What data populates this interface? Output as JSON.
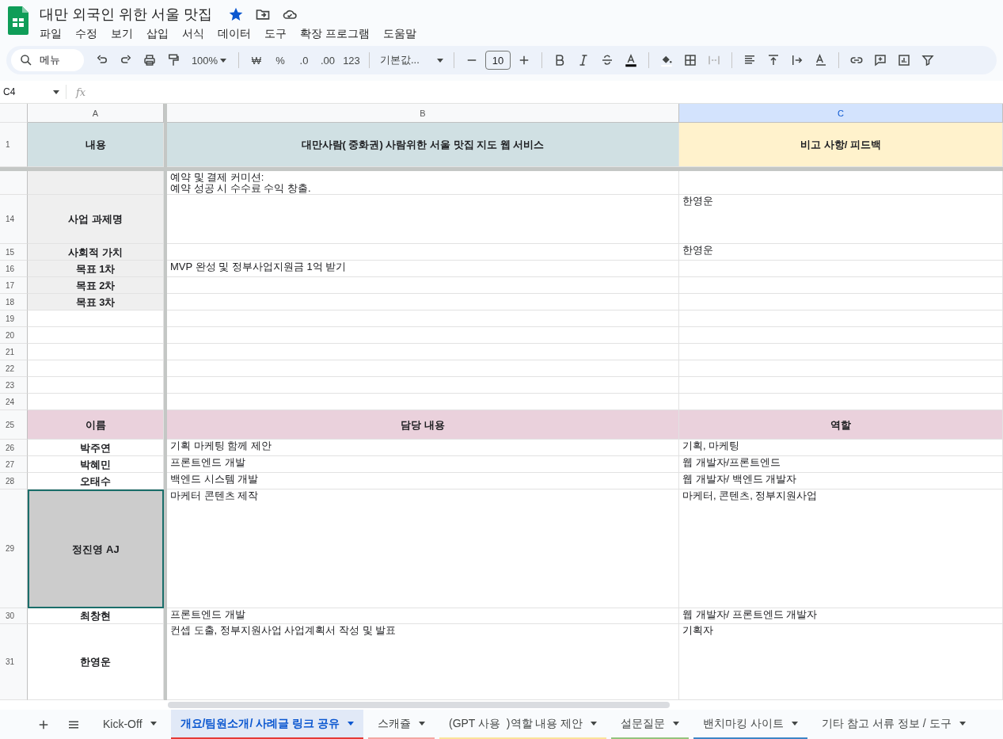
{
  "document": {
    "title": "대만 외국인 위한 서울 맛집",
    "starred": true
  },
  "menu": [
    "파일",
    "수정",
    "보기",
    "삽입",
    "서식",
    "데이터",
    "도구",
    "확장 프로그램",
    "도움말"
  ],
  "toolbar": {
    "search_label": "메뉴",
    "zoom": "100%",
    "currency": "₩",
    "percent": "%",
    "decrease_decimal": ".0",
    "increase_decimal": ".00",
    "number_format": "123",
    "font": "기본값...",
    "font_size": "10"
  },
  "formula_bar": {
    "cell_ref": "C4",
    "fx": "fx"
  },
  "columns": [
    {
      "label": "A",
      "selected": false
    },
    {
      "label": "B",
      "selected": false
    },
    {
      "label": "C",
      "selected": true
    }
  ],
  "rows": [
    {
      "number": "1",
      "cells": [
        {
          "text": "내용",
          "kind": "label",
          "color": "#d0e0e3"
        },
        {
          "text": "대만사람( 중화권) 사람위한 서울 맛집 지도 웹 서비스",
          "kind": "label",
          "color": "#d0e0e3"
        },
        {
          "text": "비고 사항/ 피드백",
          "kind": "label",
          "color": "#fff2cc"
        }
      ]
    },
    {
      "cells": [
        {
          "text": "",
          "kind": "label",
          "color": "#efefef"
        },
        {
          "text": "예약 및 결제 커미션:\n예약 성공 시 수수료 수익 창출.",
          "kind": "text"
        },
        {
          "text": "",
          "kind": "text"
        }
      ]
    },
    {
      "number": "14",
      "cells": [
        {
          "text": "사업 과제명",
          "kind": "label",
          "color": "#efefef"
        },
        {
          "text": "",
          "kind": "text"
        },
        {
          "text": "한영운",
          "kind": "text"
        }
      ]
    },
    {
      "number": "15",
      "cells": [
        {
          "text": "사회적 가치",
          "kind": "label",
          "color": "#efefef"
        },
        {
          "text": "",
          "kind": "text"
        },
        {
          "text": "한영운",
          "kind": "text"
        }
      ]
    },
    {
      "number": "16",
      "cells": [
        {
          "text": "목표 1차",
          "kind": "label",
          "color": "#efefef"
        },
        {
          "text": "MVP 완성 및 정부사업지원금 1억 받기",
          "kind": "text"
        },
        {
          "text": "",
          "kind": "text"
        }
      ]
    },
    {
      "number": "17",
      "cells": [
        {
          "text": "목표 2차",
          "kind": "label",
          "color": "#efefef"
        },
        {
          "text": "",
          "kind": "text"
        },
        {
          "text": "",
          "kind": "text"
        }
      ]
    },
    {
      "number": "18",
      "cells": [
        {
          "text": "목표 3차",
          "kind": "label",
          "color": "#efefef"
        },
        {
          "text": "",
          "kind": "text"
        },
        {
          "text": "",
          "kind": "text"
        }
      ]
    },
    {
      "number": "19",
      "cells": [
        {
          "text": "",
          "kind": "text"
        },
        {
          "text": "",
          "kind": "text"
        },
        {
          "text": "",
          "kind": "text"
        }
      ]
    },
    {
      "number": "20",
      "cells": [
        {
          "text": "",
          "kind": "text"
        },
        {
          "text": "",
          "kind": "text"
        },
        {
          "text": "",
          "kind": "text"
        }
      ]
    },
    {
      "number": "21",
      "cells": [
        {
          "text": "",
          "kind": "text"
        },
        {
          "text": "",
          "kind": "text"
        },
        {
          "text": "",
          "kind": "text"
        }
      ]
    },
    {
      "number": "22",
      "cells": [
        {
          "text": "",
          "kind": "text"
        },
        {
          "text": "",
          "kind": "text"
        },
        {
          "text": "",
          "kind": "text"
        }
      ]
    },
    {
      "number": "23",
      "cells": [
        {
          "text": "",
          "kind": "text"
        },
        {
          "text": "",
          "kind": "text"
        },
        {
          "text": "",
          "kind": "text"
        }
      ]
    },
    {
      "number": "24",
      "cells": [
        {
          "text": "",
          "kind": "text"
        },
        {
          "text": "",
          "kind": "text"
        },
        {
          "text": "",
          "kind": "text"
        }
      ]
    },
    {
      "number": "25",
      "cells": [
        {
          "text": "이름",
          "kind": "label",
          "color": "#ead1dc"
        },
        {
          "text": "담당 내용",
          "kind": "label",
          "color": "#ead1dc"
        },
        {
          "text": "역할",
          "kind": "label",
          "color": "#ead1dc"
        }
      ]
    },
    {
      "number": "26",
      "cells": [
        {
          "text": "박주연",
          "kind": "label"
        },
        {
          "text": "기획 마케팅 함께 제안",
          "kind": "text"
        },
        {
          "text": "기획, 마케팅",
          "kind": "text"
        }
      ]
    },
    {
      "number": "27",
      "cells": [
        {
          "text": "박혜민",
          "kind": "label"
        },
        {
          "text": "프론트엔드 개발",
          "kind": "text"
        },
        {
          "text": "웹 개발자/프론트엔드",
          "kind": "text"
        }
      ]
    },
    {
      "number": "28",
      "cells": [
        {
          "text": "오태수",
          "kind": "label"
        },
        {
          "text": "백엔드 시스템 개발",
          "kind": "text"
        },
        {
          "text": "웹 개발자/ 백엔드 개발자",
          "kind": "text"
        }
      ]
    },
    {
      "number": "29",
      "cells": [
        {
          "text": "정진영 AJ",
          "kind": "label",
          "color": "#cccccc",
          "outlined": true
        },
        {
          "text": "마케터 콘텐츠 제작",
          "kind": "text"
        },
        {
          "text": "마케터, 콘텐츠, 정부지원사업",
          "kind": "text"
        }
      ]
    },
    {
      "number": "30",
      "cells": [
        {
          "text": "최창현",
          "kind": "label"
        },
        {
          "text": "프론트엔드 개발",
          "kind": "text"
        },
        {
          "text": "웹 개발자/ 프론트엔드 개발자",
          "kind": "text"
        }
      ]
    },
    {
      "number": "31",
      "cells": [
        {
          "text": "한영운",
          "kind": "label"
        },
        {
          "text": "컨셉 도출,  정부지원사업 사업계획서 작성 및 발표",
          "kind": "text"
        },
        {
          "text": "기획자",
          "kind": "text"
        }
      ]
    }
  ],
  "sheet_tabs": [
    {
      "label": "Kick-Off",
      "selected": false
    },
    {
      "label": "개요/팀원소개/ 사례글 링크 공유",
      "selected": true,
      "color": "#e53935"
    },
    {
      "label": "스캐쥴",
      "selected": false,
      "color": "#f4a7a3"
    },
    {
      "label": "(GPT 사용  )역할 내용 제안",
      "selected": false,
      "color": "#fbe49a"
    },
    {
      "label": "설문질문",
      "selected": false,
      "color": "#93c47d"
    },
    {
      "label": "밴치마킹 사이트",
      "selected": false,
      "color": "#3d85c6"
    },
    {
      "label": "기타 참고 서류 정보 / 도구",
      "selected": false
    }
  ]
}
